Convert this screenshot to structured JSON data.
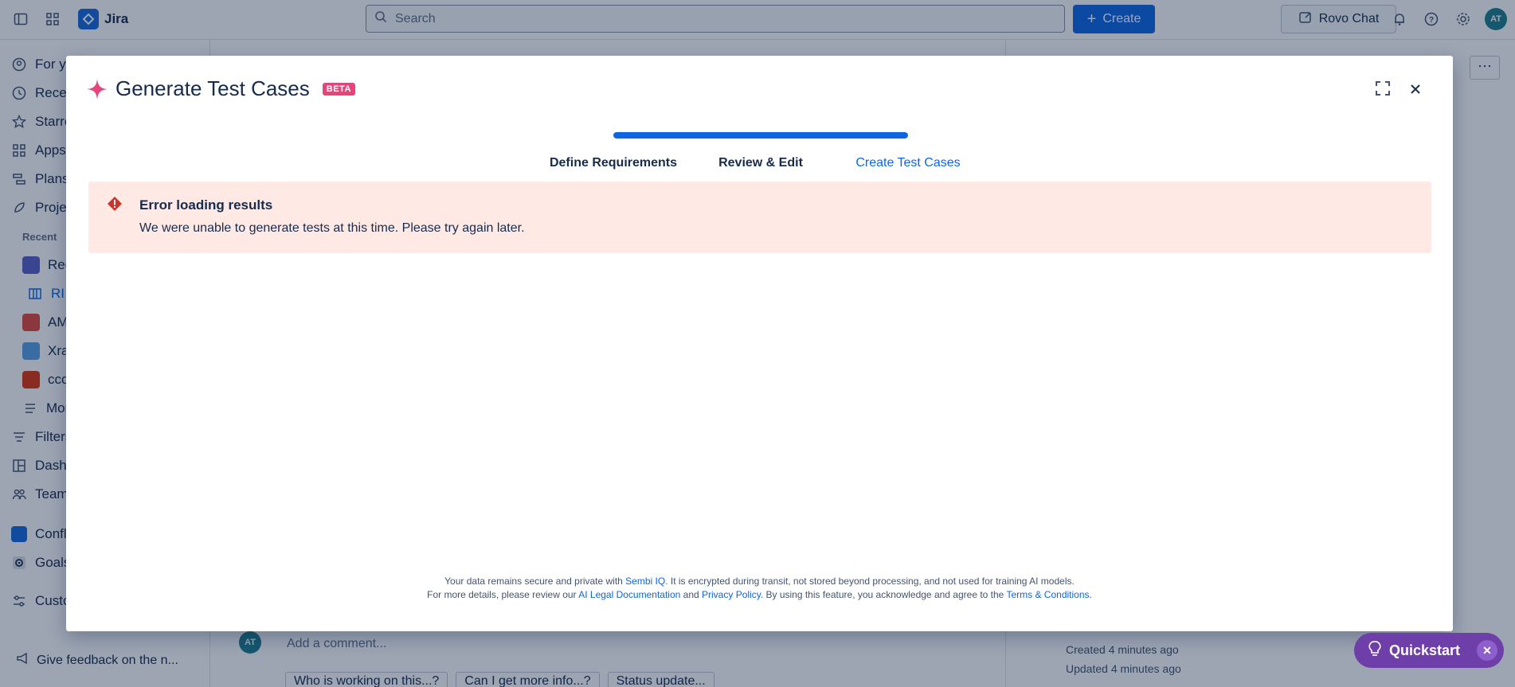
{
  "topbar": {
    "app_name": "Jira",
    "search_placeholder": "Search",
    "create_label": "Create",
    "rovo_label": "Rovo Chat",
    "avatar_initials": "AT"
  },
  "sidebar": {
    "items": [
      {
        "label": "For yo",
        "icon": "person-circle-icon"
      },
      {
        "label": "Recen",
        "icon": "clock-icon"
      },
      {
        "label": "Starre",
        "icon": "star-icon"
      },
      {
        "label": "Apps",
        "icon": "apps-grid-icon"
      },
      {
        "label": "Plans",
        "icon": "plans-icon"
      },
      {
        "label": "Projec",
        "icon": "rocket-icon"
      }
    ],
    "recent_heading": "Recent",
    "recent_items": [
      {
        "label": "Rec",
        "color": "#5b5fc7"
      },
      {
        "label": "RI",
        "color": "#0c66e4"
      },
      {
        "label": "AM",
        "color": "#e2483d"
      },
      {
        "label": "Xra",
        "color": "#5aa0e6"
      },
      {
        "label": "cco",
        "color": "#de350b"
      },
      {
        "label": "Mor",
        "color": "#44546f"
      }
    ],
    "lower_items": [
      {
        "label": "Filters",
        "icon": "filter-icon"
      },
      {
        "label": "Dash",
        "icon": "dashboard-icon"
      },
      {
        "label": "Team",
        "icon": "team-icon"
      },
      {
        "label": "Confl",
        "icon": "confluence-icon"
      },
      {
        "label": "Goals",
        "icon": "goals-icon"
      },
      {
        "label": "Custo",
        "icon": "customize-icon"
      }
    ],
    "feedback": "Give feedback on the n..."
  },
  "background": {
    "comment_placeholder": "Add a comment...",
    "chips": [
      "Who is working on this...?",
      "Can I get more info...?",
      "Status update..."
    ],
    "created": "Created 4 minutes ago",
    "updated": "Updated 4 minutes ago"
  },
  "modal": {
    "title": "Generate Test Cases",
    "badge": "BETA",
    "progress_fraction": 1.0,
    "steps": [
      {
        "label": "Define Requirements",
        "state": "done"
      },
      {
        "label": "Review & Edit",
        "state": "done"
      },
      {
        "label": "Create Test Cases",
        "state": "active"
      }
    ],
    "error": {
      "title": "Error loading results",
      "message": "We were unable to generate tests at this time. Please try again later."
    },
    "footer": {
      "line1_pre": "Your data remains secure and private with ",
      "line1_link": "Sembi IQ",
      "line1_post": ". It is encrypted during transit, not stored beyond processing, and not used for training AI models.",
      "line2_pre": "For more details, please review our ",
      "line2_link1": "AI Legal Documentation",
      "line2_and": " and ",
      "line2_link2": "Privacy Policy",
      "line2_mid": ". By using this feature, you acknowledge and agree to the ",
      "line2_link3": "Terms & Conditions",
      "line2_end": "."
    }
  },
  "quickstart": {
    "label": "Quickstart"
  },
  "colors": {
    "brand_blue": "#0c66e4",
    "error_bg": "#ffe9e4",
    "error_icon": "#c9372c",
    "quickstart": "#6e3fa8",
    "beta_badge": "#e6447d"
  }
}
